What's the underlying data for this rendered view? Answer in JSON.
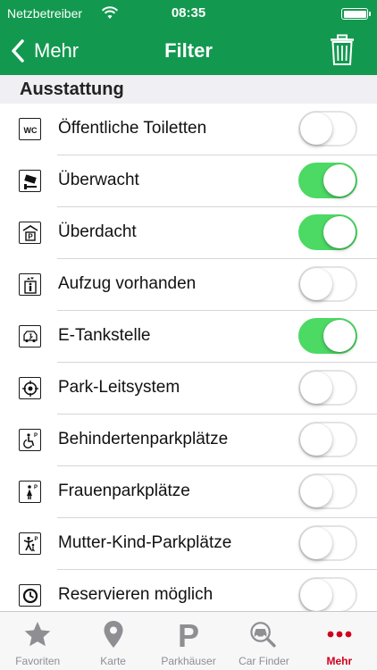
{
  "status_bar": {
    "carrier": "Netzbetreiber",
    "time": "08:35",
    "wifi_icon": "wifi-icon",
    "battery_level": 1.0
  },
  "nav": {
    "back_label": "Mehr",
    "title": "Filter",
    "trash_icon": "trash-icon"
  },
  "section": {
    "title": "Ausstattung"
  },
  "items": [
    {
      "label": "Öffentliche Toiletten",
      "icon": "wc-icon",
      "on": false
    },
    {
      "label": "Überwacht",
      "icon": "camera-icon",
      "on": true
    },
    {
      "label": "Überdacht",
      "icon": "covered-parking-icon",
      "on": true
    },
    {
      "label": "Aufzug vorhanden",
      "icon": "elevator-icon",
      "on": false
    },
    {
      "label": "E-Tankstelle",
      "icon": "ev-charging-icon",
      "on": true
    },
    {
      "label": "Park-Leitsystem",
      "icon": "guidance-system-icon",
      "on": false
    },
    {
      "label": "Behindertenparkplätze",
      "icon": "wheelchair-icon",
      "on": false
    },
    {
      "label": "Frauenparkplätze",
      "icon": "women-parking-icon",
      "on": false
    },
    {
      "label": "Mutter-Kind-Parkplätze",
      "icon": "family-parking-icon",
      "on": false
    },
    {
      "label": "Reservieren möglich",
      "icon": "reservation-icon",
      "on": false
    }
  ],
  "tabs": [
    {
      "label": "Favoriten",
      "icon": "star-icon",
      "active": false
    },
    {
      "label": "Karte",
      "icon": "map-pin-icon",
      "active": false
    },
    {
      "label": "Parkhäuser",
      "icon": "parking-p-icon",
      "active": false
    },
    {
      "label": "Car Finder",
      "icon": "car-finder-icon",
      "active": false
    },
    {
      "label": "Mehr",
      "icon": "more-dots-icon",
      "active": true
    }
  ],
  "colors": {
    "brand_green": "#12994f",
    "switch_on": "#4cd964",
    "tab_active": "#d0021b",
    "tab_inactive": "#8e8e93"
  }
}
